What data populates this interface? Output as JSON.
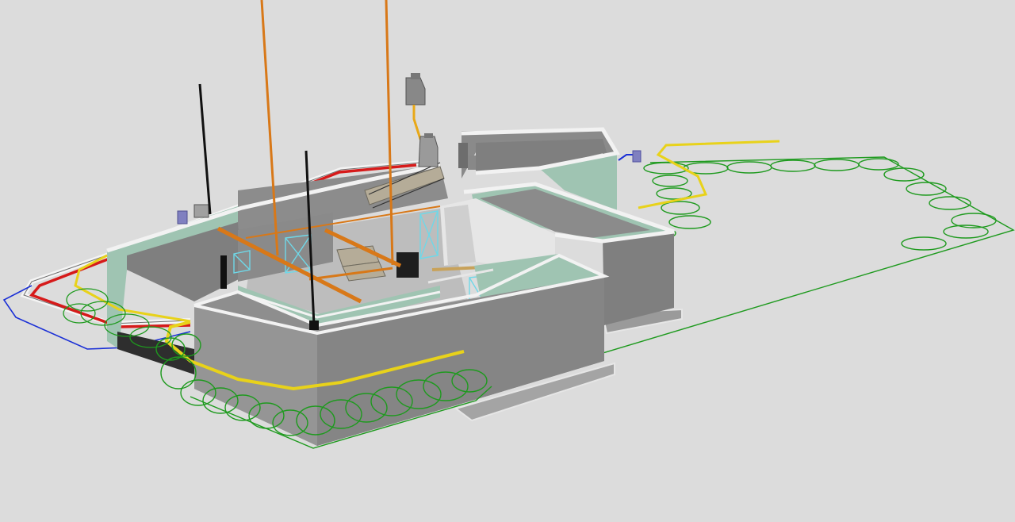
{
  "scene": {
    "background": "#dcdcdc",
    "colors": {
      "wall_concrete": "#8e8e8e",
      "wall_concrete_dark": "#7a7a7a",
      "wall_interior_green": "#9fc4b2",
      "wall_top": "#f2f2f2",
      "floor_light": "#c8c8c8",
      "pipe_red": "#d61a1a",
      "pipe_blue": "#1a2fd6",
      "pipe_yellow": "#e8d21a",
      "pipe_white": "#f4f4f4",
      "pipe_green": "#1e9a1e",
      "vent_orange": "#d87818",
      "vent_black": "#111111",
      "glass_cyan": "#6fd8e8"
    },
    "elements": [
      "concrete-foundation-walls",
      "ground-source-heat-coil",
      "utility-pipes",
      "vent-stacks",
      "chimney-units",
      "interior-staircase"
    ]
  }
}
